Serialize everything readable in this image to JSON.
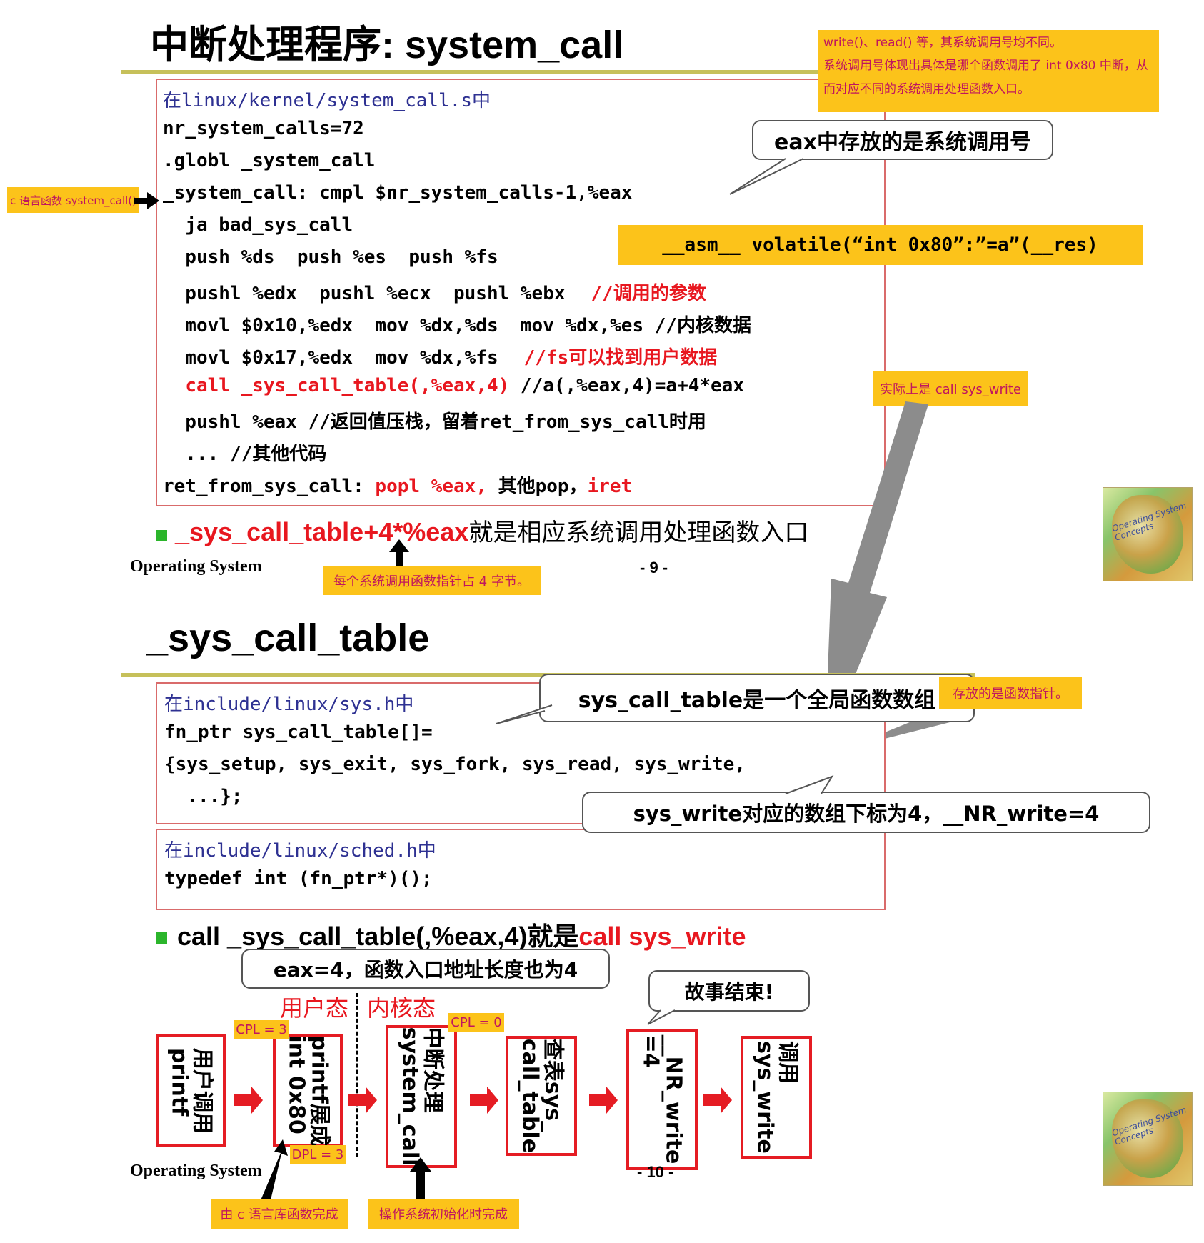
{
  "slide1": {
    "title": "中断处理程序: system_call",
    "code_header": "在linux/kernel/system_call.s中",
    "code_lines": [
      "nr_system_calls=72",
      ".globl _system_call",
      "_system_call: cmpl $nr_system_calls-1,%eax",
      "  ja bad_sys_call",
      "  push %ds  push %es  push %fs",
      "  pushl %edx  pushl %ecx  pushl %ebx",
      "  movl $0x10,%edx  mov %dx,%ds  mov %dx,%es //内核数据",
      "  movl $0x17,%edx  mov %dx,%fs",
      "  ",
      "  pushl %eax //返回值压栈，留着ret_from_sys_call时用",
      "  ... //其他代码"
    ],
    "comment_params": "//调用的参数",
    "comment_fs": "//fs可以找到用户数据",
    "call_red": "call _sys_call_table(,%eax,4)",
    "call_comment": " //a(,%eax,4)=a+4*eax",
    "ret_label": "ret_from_sys_call: ",
    "ret_popl": "popl %eax,",
    "ret_other": " 其他pop，",
    "ret_iret": "iret",
    "note_top": "write()、read() 等，其系统调用号均不同。\n系统调用号体现出具体是哪个函数调用了 int 0x80 中断，从而对应不同的系统调用处理函数入口。",
    "bubble_eax": "eax中存放的是系统调用号",
    "asm_box": "__asm__ volatile(“int 0x80”:”=a”(__res)",
    "note_c": "c 语言函数 system_call()",
    "note_call": "实际上是 call sys_write",
    "bullet_red": "_sys_call_table+4*%eax",
    "bullet_black": "就是相应系统调用处理函数入口",
    "note_ptr": "每个系统调用函数指针占 4 字节。",
    "footer": "Operating System",
    "page": "- 9 -"
  },
  "slide2": {
    "title": "_sys_call_table",
    "code1_header": "在include/linux/sys.h中",
    "code1_lines": [
      "fn_ptr sys_call_table[]=",
      "{sys_setup, sys_exit, sys_fork, sys_read, sys_write,",
      "  ...};"
    ],
    "code2_header": "在include/linux/sched.h中",
    "code2_lines": [
      "typedef int (fn_ptr*)();"
    ],
    "bubble_table": "sys_call_table是一个全局函数数组",
    "note_fnptr": "存放的是函数指针。",
    "bubble_write": "sys_write对应的数组下标为4，__NR_write=4",
    "bullet_black1": "call _sys_call_table(,%eax,4)就是",
    "bullet_red": "call sys_write",
    "bubble_eax4": "eax=4，函数入口地址长度也为4",
    "label_user": "用户态",
    "label_kernel": "内核态",
    "bubble_end": "故事结束!",
    "flow": [
      "用户调用\nprintf",
      "printf展成\nint 0x80",
      "中断处理\nsystem_call",
      "查表sys_\ncall_table",
      "__NR_write\n=4",
      "调用\nsys_write"
    ],
    "tag_cpl3": "CPL = 3",
    "tag_cpl0": "CPL = 0",
    "tag_dpl3": "DPL = 3",
    "note_clib": "由 c 语言库函数完成",
    "note_osinit": "操作系统初始化时完成",
    "footer": "Operating System",
    "page": "- 10 -"
  },
  "book_cover": "Operating System Concepts"
}
